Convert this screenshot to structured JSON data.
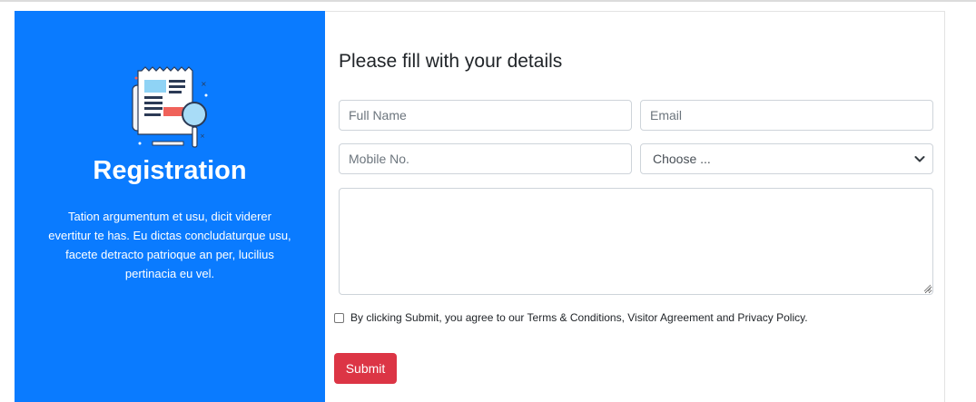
{
  "left_panel": {
    "title": "Registration",
    "description": "Tation argumentum et usu, dicit viderer evertitur te has. Eu dictas concludaturque usu, facete detracto patrioque an per, lucilius pertinacia eu vel.",
    "illustration_icon": "newspaper-magnifier-icon",
    "bg_color": "#0a7bff"
  },
  "form": {
    "title": "Please fill with your details",
    "full_name": {
      "placeholder": "Full Name",
      "value": ""
    },
    "email": {
      "placeholder": "Email",
      "value": ""
    },
    "mobile": {
      "placeholder": "Mobile No.",
      "value": ""
    },
    "select": {
      "selected": "Choose ..."
    },
    "message": {
      "value": ""
    },
    "agreement_text": "By clicking Submit, you agree to our Terms & Conditions, Visitor Agreement and Privacy Policy.",
    "agreement_checked": false,
    "submit_label": "Submit",
    "submit_color": "#dc3545"
  }
}
